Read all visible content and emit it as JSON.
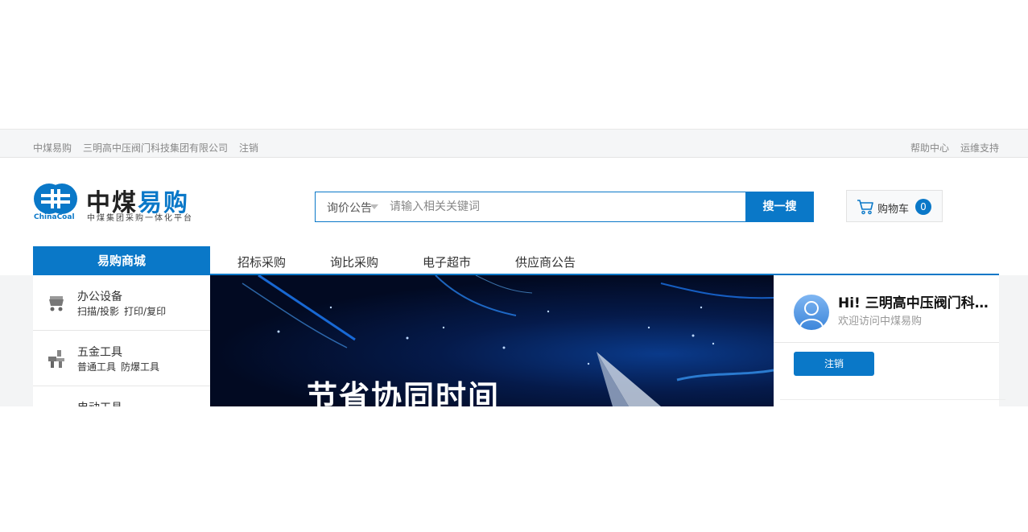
{
  "topbar": {
    "left_links": [
      "中煤易购",
      "三明高中压阀门科技集团有限公司",
      "注销"
    ],
    "right_links": [
      "帮助中心",
      "运维支持"
    ]
  },
  "logo": {
    "name_dark": "中煤",
    "name_blue": "易购",
    "subtitle": "中煤集团采购一体化平台",
    "en": "ChinaCoal"
  },
  "search": {
    "category": "询价公告",
    "placeholder": "请输入相关关键词",
    "button": "搜一搜"
  },
  "cart": {
    "label": "购物车",
    "count": "0"
  },
  "nav": {
    "category_title": "易购商城",
    "links": [
      "招标采购",
      "询比采购",
      "电子超市",
      "供应商公告"
    ]
  },
  "sidebar": {
    "items": [
      {
        "title": "办公设备",
        "subs": [
          "扫描/投影",
          "打印/复印"
        ],
        "icon": "cart-trolley-icon"
      },
      {
        "title": "五金工具",
        "subs": [
          "普通工具",
          "防爆工具"
        ],
        "icon": "tools-icon"
      },
      {
        "title": "电动工具",
        "subs": [],
        "icon": "power-tool-icon"
      }
    ]
  },
  "banner": {
    "headline": "节省协同时间"
  },
  "user": {
    "greeting": "Hi! 三明高中压阀门科技集团有限公司",
    "welcome": "欢迎访问中煤易购",
    "logout": "注销"
  },
  "colors": {
    "accent": "#0a78c8",
    "topbar_bg": "#f5f6f7",
    "banner_dark": "#020a22"
  }
}
